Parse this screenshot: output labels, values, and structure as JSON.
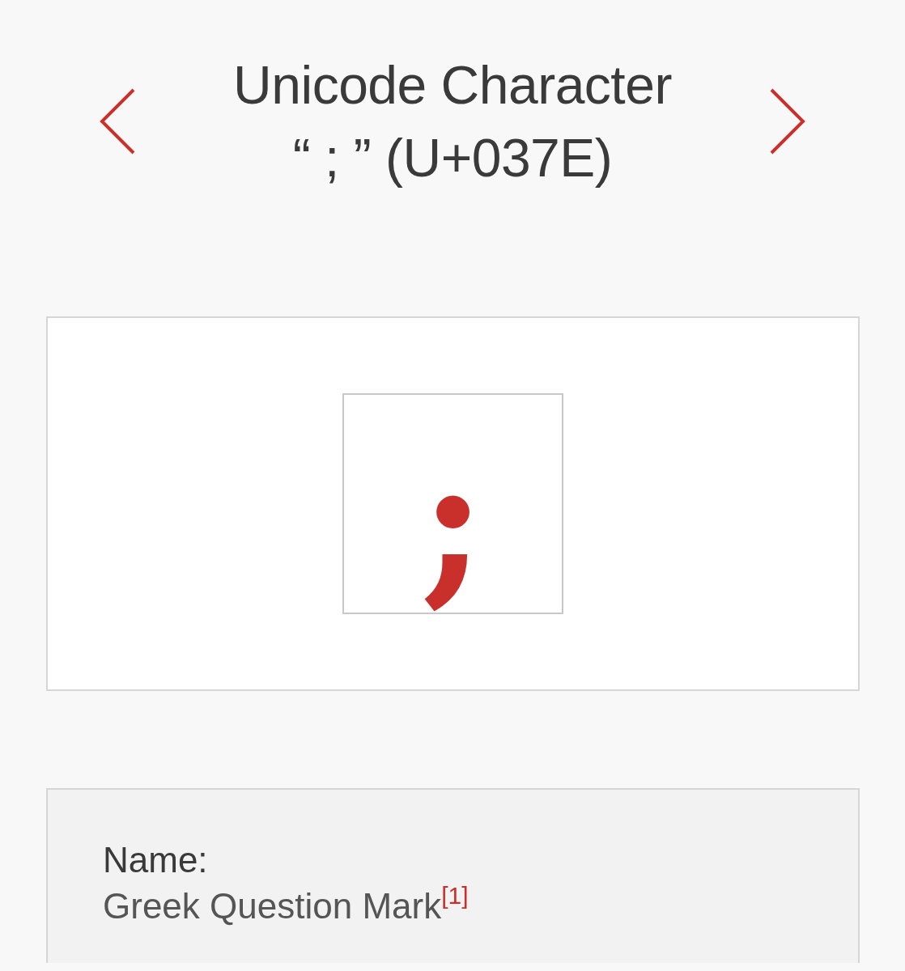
{
  "header": {
    "title_lines": [
      "Unicode Character",
      "“ ; ” (U+037E)"
    ]
  },
  "preview": {
    "glyph": ";"
  },
  "info": {
    "fields": [
      {
        "label": "Name:",
        "value": "Greek Question Mark$^{[1]}$"
      }
    ]
  }
}
